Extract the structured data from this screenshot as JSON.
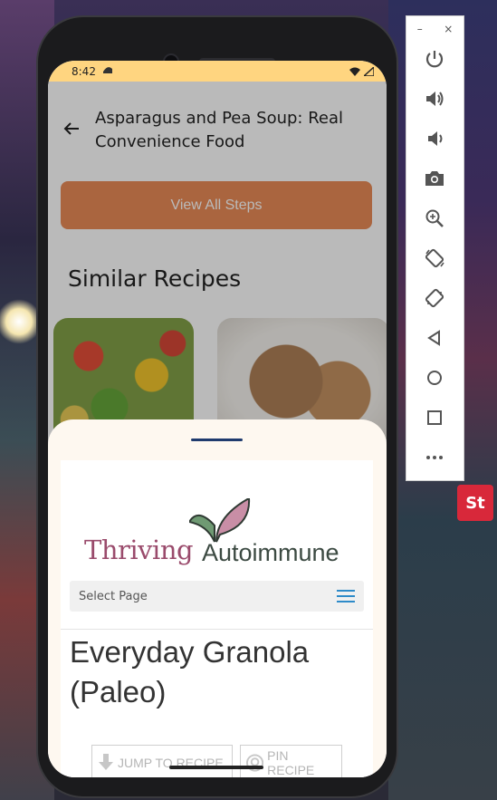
{
  "status_bar": {
    "time": "8:42"
  },
  "header": {
    "title": "Asparagus and Pea Soup: Real Convenience Food"
  },
  "actions": {
    "view_steps": "View All Steps"
  },
  "similar": {
    "heading": "Similar Recipes"
  },
  "web_page": {
    "logo_word1": "Thriving",
    "logo_word2": "Autoimmune",
    "menu_label": "Select Page",
    "post_title": "Everyday Granola (Paleo)",
    "jump_button": "JUMP TO RECIPE",
    "pin_button": "PIN RECIPE"
  },
  "background": {
    "sign_text": "St"
  },
  "emulator_panel": {
    "minimize": "–",
    "close": "×",
    "tools": [
      "power-icon",
      "volume-up-icon",
      "volume-down-icon",
      "camera-icon",
      "zoom-icon",
      "rotate-left-icon",
      "rotate-right-icon",
      "back-icon",
      "home-icon",
      "overview-icon",
      "more-icon"
    ]
  },
  "colors": {
    "accent": "#e8824a",
    "status_bar": "#ffd580",
    "sheet_bg": "#fef8f0",
    "logo_purple": "#9a4b6c"
  }
}
